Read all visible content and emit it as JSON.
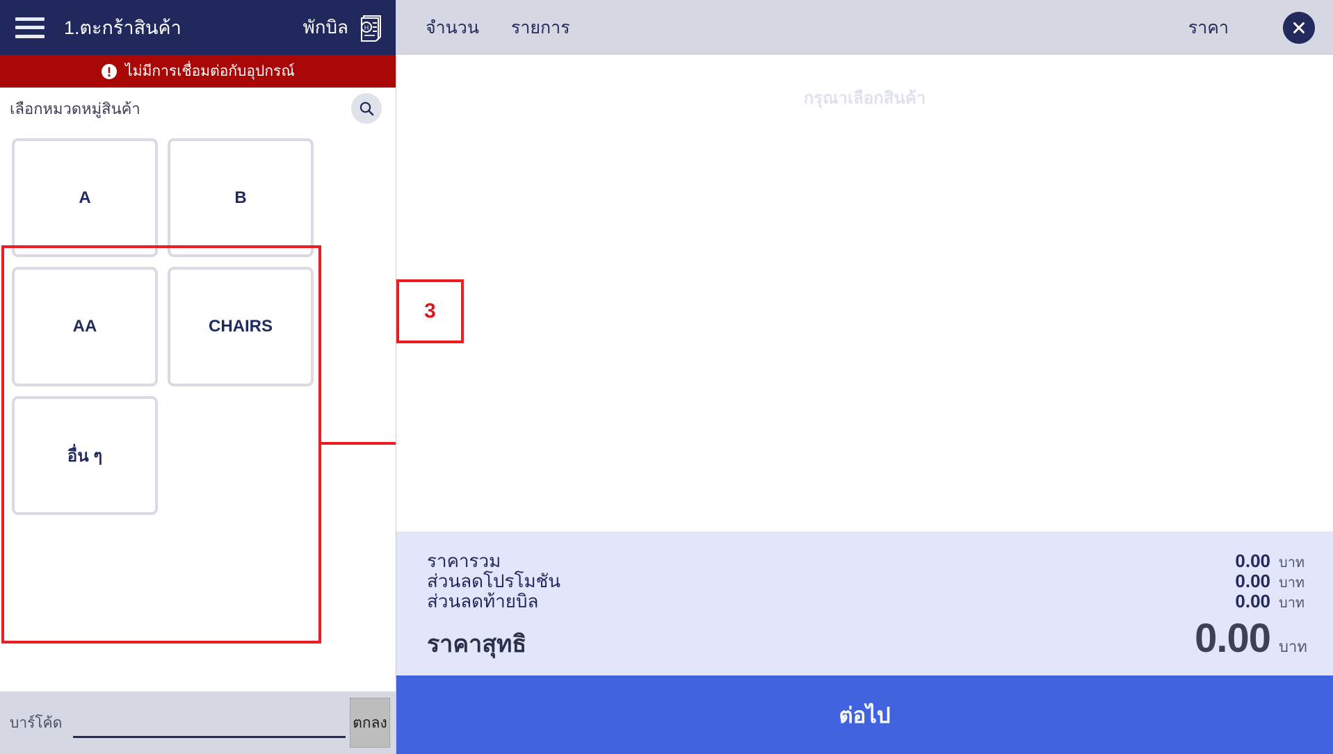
{
  "left": {
    "topbar": {
      "menu_icon": "hamburger-menu-icon",
      "title": "1.ตะกร้าสินค้า",
      "hold_bill_label": "พักบิล",
      "hold_bill_icon": "hold-bill-document-icon"
    },
    "offline_banner": {
      "icon": "alert-exclamation-icon",
      "text": "ไม่มีการเชื่อมต่อกับอุปกรณ์"
    },
    "category_bar": {
      "label": "เลือกหมวดหมู่สินค้า",
      "search_icon": "search-icon"
    },
    "categories": [
      {
        "label": "A",
        "thai": false
      },
      {
        "label": "B",
        "thai": false
      },
      {
        "label": "AA",
        "thai": false
      },
      {
        "label": "CHAIRS",
        "thai": false
      },
      {
        "label": "อื่น ๆ",
        "thai": true
      }
    ],
    "barcode": {
      "label": "บาร์โค้ด",
      "value": "",
      "placeholder": "",
      "ok_label": "ตกลง"
    }
  },
  "annotation": {
    "number": "3",
    "color": "#ee1c25"
  },
  "right": {
    "header": {
      "qty_label": "จำนวน",
      "item_label": "รายการ",
      "price_label": "ราคา",
      "close_icon": "close-x-icon"
    },
    "cart": {
      "empty_text": "กรุณาเลือกสินค้า"
    },
    "summary": {
      "rows": [
        {
          "label": "ราคารวม",
          "value": "0.00",
          "unit": "บาท"
        },
        {
          "label": "ส่วนลดโปรโมชัน",
          "value": "0.00",
          "unit": "บาท"
        },
        {
          "label": "ส่วนลดท้ายบิล",
          "value": "0.00",
          "unit": "บาท"
        }
      ],
      "net": {
        "label": "ราคาสุทธิ",
        "value": "0.00",
        "unit": "บาท"
      }
    },
    "next_button": {
      "label": "ต่อไป"
    }
  },
  "colors": {
    "navy": "#21295c",
    "red_banner": "#a90606",
    "annotation_red": "#ee1c25",
    "header_gray": "#d5d8e2",
    "summary_bg": "#e3e6fb",
    "primary_blue": "#4263e0",
    "tile_border": "#d8dbe4"
  }
}
